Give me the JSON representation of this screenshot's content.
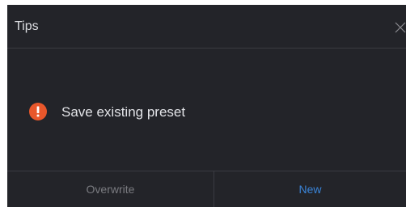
{
  "dialog": {
    "title": "Tips",
    "close_icon": "close-icon",
    "message": "Save existing preset",
    "message_icon": "warning-icon",
    "buttons": {
      "overwrite_label": "Overwrite",
      "new_label": "New"
    }
  },
  "colors": {
    "background": "#232429",
    "warning": "#e8572b",
    "primary_action": "#3a84d8",
    "secondary_action": "#7a7b80",
    "text": "#e3e4e8"
  }
}
